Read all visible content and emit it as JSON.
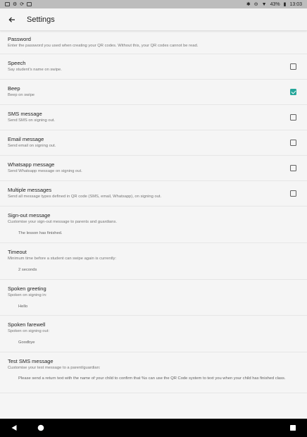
{
  "status_bar": {
    "battery": "43%",
    "time": "13:03"
  },
  "app_bar": {
    "title": "Settings"
  },
  "settings": [
    {
      "title": "Password",
      "subtitle": "Enter the password you used when creating your QR codes. Without this, your QR codes cannot be read."
    },
    {
      "title": "Speech",
      "subtitle": "Say student's name on swipe.",
      "checked": false
    },
    {
      "title": "Beep",
      "subtitle": "Beep on swipe",
      "checked": true
    },
    {
      "title": "SMS message",
      "subtitle": "Send SMS on signing out.",
      "checked": false
    },
    {
      "title": "Email message",
      "subtitle": "Send email on signing out.",
      "checked": false
    },
    {
      "title": "Whatsapp message",
      "subtitle": "Send Whatsapp message on signing out.",
      "checked": false
    },
    {
      "title": "Multiple messages",
      "subtitle": "Send all message types defined in QR code (SMS, email, Whatsapp), on signing out.",
      "checked": false
    },
    {
      "title": "Sign-out message",
      "subtitle": "Customise your sign-out message to parents and guardians.",
      "value": "The lesson has finished."
    },
    {
      "title": "Timeout",
      "subtitle": "Minimum time before a student can swipe again is currently:",
      "value": "2 seconds"
    },
    {
      "title": "Spoken greeting",
      "subtitle": "Spoken on signing in:",
      "value": "Hello"
    },
    {
      "title": "Spoken farewell",
      "subtitle": "Spoken on signing out:",
      "value": "Goodbye"
    },
    {
      "title": "Test SMS message",
      "subtitle": "Customise your test message to a parent/guardian:",
      "value": "Please send a return text with the name of your child to confirm that %s can use the QR Code system to text you when your child has finished class."
    }
  ],
  "colors": {
    "accent": "#26a69a",
    "nav_bar": "#000000",
    "status_bar": "#bdbdbd"
  }
}
